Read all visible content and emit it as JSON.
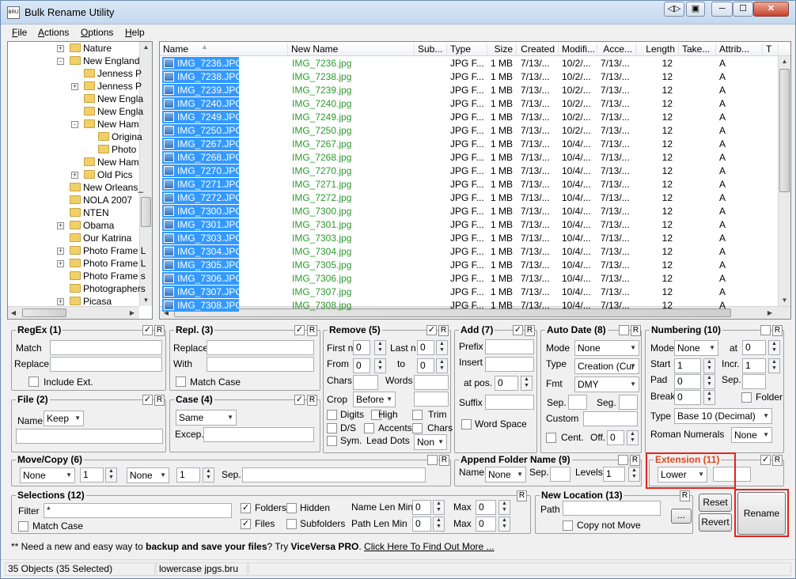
{
  "window": {
    "title": "Bulk Rename Utility",
    "app_icon": "BRU"
  },
  "caption_buttons": {
    "restore_down": "◁▷",
    "icon_box": "▣",
    "minimize": "─",
    "maximize": "☐",
    "close": "✕"
  },
  "menu": [
    {
      "first": "F",
      "rest": "ile"
    },
    {
      "first": "A",
      "rest": "ctions"
    },
    {
      "first": "O",
      "rest": "ptions"
    },
    {
      "first": "H",
      "rest": "elp"
    }
  ],
  "tree": [
    {
      "label": "Nature",
      "level": 1,
      "expander": "+"
    },
    {
      "label": "New England",
      "level": 1,
      "expander": "-"
    },
    {
      "label": "Jenness P",
      "level": 2,
      "expander": ""
    },
    {
      "label": "Jenness P",
      "level": 2,
      "expander": "+"
    },
    {
      "label": "New Engla",
      "level": 2,
      "expander": ""
    },
    {
      "label": "New Engla",
      "level": 2,
      "expander": ""
    },
    {
      "label": "New Ham",
      "level": 2,
      "expander": "-"
    },
    {
      "label": "Origina",
      "level": 3,
      "expander": ""
    },
    {
      "label": "Photo",
      "level": 3,
      "expander": ""
    },
    {
      "label": "New Ham",
      "level": 2,
      "expander": ""
    },
    {
      "label": "Old Pics",
      "level": 2,
      "expander": "+"
    },
    {
      "label": "New Orleans_",
      "level": 1,
      "expander": ""
    },
    {
      "label": "NOLA 2007",
      "level": 1,
      "expander": ""
    },
    {
      "label": "NTEN",
      "level": 1,
      "expander": ""
    },
    {
      "label": "Obama",
      "level": 1,
      "expander": "+"
    },
    {
      "label": "Our Katrina",
      "level": 1,
      "expander": ""
    },
    {
      "label": "Photo Frame L",
      "level": 1,
      "expander": "+"
    },
    {
      "label": "Photo Frame L",
      "level": 1,
      "expander": "+"
    },
    {
      "label": "Photo Frame s",
      "level": 1,
      "expander": ""
    },
    {
      "label": "Photographers",
      "level": 1,
      "expander": ""
    },
    {
      "label": "Picasa",
      "level": 1,
      "expander": "+"
    }
  ],
  "columns": [
    "Name",
    "New Name",
    "Sub...",
    "Type",
    "Size",
    "Created",
    "Modifi...",
    "Acce...",
    "Length",
    "Take...",
    "Attrib...",
    "T"
  ],
  "files": [
    {
      "name": "IMG_7236.JPG",
      "new": "IMG_7236.jpg",
      "type": "JPG F...",
      "size": "1 MB",
      "created": "7/13/...",
      "modified": "10/2/...",
      "accessed": "7/13/...",
      "length": "12",
      "attrib": "A"
    },
    {
      "name": "IMG_7238.JPG",
      "new": "IMG_7238.jpg",
      "type": "JPG F...",
      "size": "1 MB",
      "created": "7/13/...",
      "modified": "10/2/...",
      "accessed": "7/13/...",
      "length": "12",
      "attrib": "A"
    },
    {
      "name": "IMG_7239.JPG",
      "new": "IMG_7239.jpg",
      "type": "JPG F...",
      "size": "1 MB",
      "created": "7/13/...",
      "modified": "10/2/...",
      "accessed": "7/13/...",
      "length": "12",
      "attrib": "A"
    },
    {
      "name": "IMG_7240.JPG",
      "new": "IMG_7240.jpg",
      "type": "JPG F...",
      "size": "1 MB",
      "created": "7/13/...",
      "modified": "10/2/...",
      "accessed": "7/13/...",
      "length": "12",
      "attrib": "A"
    },
    {
      "name": "IMG_7249.JPG",
      "new": "IMG_7249.jpg",
      "type": "JPG F...",
      "size": "1 MB",
      "created": "7/13/...",
      "modified": "10/2/...",
      "accessed": "7/13/...",
      "length": "12",
      "attrib": "A"
    },
    {
      "name": "IMG_7250.JPG",
      "new": "IMG_7250.jpg",
      "type": "JPG F...",
      "size": "1 MB",
      "created": "7/13/...",
      "modified": "10/2/...",
      "accessed": "7/13/...",
      "length": "12",
      "attrib": "A"
    },
    {
      "name": "IMG_7267.JPG",
      "new": "IMG_7267.jpg",
      "type": "JPG F...",
      "size": "1 MB",
      "created": "7/13/...",
      "modified": "10/4/...",
      "accessed": "7/13/...",
      "length": "12",
      "attrib": "A"
    },
    {
      "name": "IMG_7268.JPG",
      "new": "IMG_7268.jpg",
      "type": "JPG F...",
      "size": "1 MB",
      "created": "7/13/...",
      "modified": "10/4/...",
      "accessed": "7/13/...",
      "length": "12",
      "attrib": "A"
    },
    {
      "name": "IMG_7270.JPG",
      "new": "IMG_7270.jpg",
      "type": "JPG F...",
      "size": "1 MB",
      "created": "7/13/...",
      "modified": "10/4/...",
      "accessed": "7/13/...",
      "length": "12",
      "attrib": "A"
    },
    {
      "name": "IMG_7271.JPG",
      "new": "IMG_7271.jpg",
      "type": "JPG F...",
      "size": "1 MB",
      "created": "7/13/...",
      "modified": "10/4/...",
      "accessed": "7/13/...",
      "length": "12",
      "attrib": "A"
    },
    {
      "name": "IMG_7272.JPG",
      "new": "IMG_7272.jpg",
      "type": "JPG F...",
      "size": "1 MB",
      "created": "7/13/...",
      "modified": "10/4/...",
      "accessed": "7/13/...",
      "length": "12",
      "attrib": "A"
    },
    {
      "name": "IMG_7300.JPG",
      "new": "IMG_7300.jpg",
      "type": "JPG F...",
      "size": "1 MB",
      "created": "7/13/...",
      "modified": "10/4/...",
      "accessed": "7/13/...",
      "length": "12",
      "attrib": "A"
    },
    {
      "name": "IMG_7301.JPG",
      "new": "IMG_7301.jpg",
      "type": "JPG F...",
      "size": "1 MB",
      "created": "7/13/...",
      "modified": "10/4/...",
      "accessed": "7/13/...",
      "length": "12",
      "attrib": "A"
    },
    {
      "name": "IMG_7303.JPG",
      "new": "IMG_7303.jpg",
      "type": "JPG F...",
      "size": "1 MB",
      "created": "7/13/...",
      "modified": "10/4/...",
      "accessed": "7/13/...",
      "length": "12",
      "attrib": "A"
    },
    {
      "name": "IMG_7304.JPG",
      "new": "IMG_7304.jpg",
      "type": "JPG F...",
      "size": "1 MB",
      "created": "7/13/...",
      "modified": "10/4/...",
      "accessed": "7/13/...",
      "length": "12",
      "attrib": "A"
    },
    {
      "name": "IMG_7305.JPG",
      "new": "IMG_7305.jpg",
      "type": "JPG F...",
      "size": "1 MB",
      "created": "7/13/...",
      "modified": "10/4/...",
      "accessed": "7/13/...",
      "length": "12",
      "attrib": "A"
    },
    {
      "name": "IMG_7306.JPG",
      "new": "IMG_7306.jpg",
      "type": "JPG F...",
      "size": "1 MB",
      "created": "7/13/...",
      "modified": "10/4/...",
      "accessed": "7/13/...",
      "length": "12",
      "attrib": "A"
    },
    {
      "name": "IMG_7307.JPG",
      "new": "IMG_7307.jpg",
      "type": "JPG F...",
      "size": "1 MB",
      "created": "7/13/...",
      "modified": "10/4/...",
      "accessed": "7/13/...",
      "length": "12",
      "attrib": "A"
    },
    {
      "name": "IMG_7308.JPG",
      "new": "IMG_7308.jpg",
      "type": "JPG F...",
      "size": "1 MB",
      "created": "7/13/...",
      "modified": "10/4/...",
      "accessed": "7/13/...",
      "length": "12",
      "attrib": "A"
    }
  ],
  "panels": {
    "regex": {
      "title": "RegEx (1)",
      "match": "Match",
      "replace": "Replace",
      "include_ext": "Include Ext."
    },
    "repl": {
      "title": "Repl. (3)",
      "replace": "Replace",
      "with": "With",
      "match_case": "Match Case"
    },
    "remove": {
      "title": "Remove (5)",
      "first_n": "First n",
      "first_n_val": "0",
      "last_n": "Last n",
      "last_n_val": "0",
      "from": "From",
      "from_val": "0",
      "to": "to",
      "to_val": "0",
      "chars": "Chars",
      "words": "Words",
      "crop": "Crop",
      "crop_val": "Before",
      "digits": "Digits",
      "high": "High",
      "trim": "Trim",
      "ds": "D/S",
      "accents": "Accents",
      "chars2": "Chars",
      "sym": "Sym.",
      "lead_dots": "Lead Dots",
      "lead_dots_val": "Non"
    },
    "add": {
      "title": "Add (7)",
      "prefix": "Prefix",
      "insert": "Insert",
      "at_pos": "at pos.",
      "at_pos_val": "0",
      "suffix": "Suffix",
      "word_space": "Word Space"
    },
    "autodate": {
      "title": "Auto Date (8)",
      "mode": "Mode",
      "mode_val": "None",
      "type": "Type",
      "type_val": "Creation (Cur",
      "fmt": "Fmt",
      "fmt_val": "DMY",
      "sep": "Sep.",
      "seg": "Seg.",
      "custom": "Custom",
      "cent": "Cent.",
      "off": "Off.",
      "off_val": "0"
    },
    "numbering": {
      "title": "Numbering (10)",
      "mode": "Mode",
      "mode_val": "None",
      "at": "at",
      "at_val": "0",
      "start": "Start",
      "start_val": "1",
      "incr": "Incr.",
      "incr_val": "1",
      "pad": "Pad",
      "pad_val": "0",
      "sep": "Sep.",
      "break": "Break",
      "break_val": "0",
      "folder": "Folder",
      "type": "Type",
      "type_val": "Base 10 (Decimal)",
      "roman": "Roman Numerals",
      "roman_val": "None"
    },
    "file": {
      "title": "File (2)",
      "name": "Name",
      "name_val": "Keep"
    },
    "case": {
      "title": "Case (4)",
      "case_val": "Same",
      "excep": "Excep."
    },
    "movecopy": {
      "title": "Move/Copy (6)",
      "sel1": "None",
      "num1": "1",
      "sel2": "None",
      "num2": "1",
      "sep": "Sep."
    },
    "append": {
      "title": "Append Folder Name (9)",
      "name": "Name",
      "name_val": "None",
      "sep": "Sep.",
      "levels": "Levels",
      "levels_val": "1"
    },
    "extension": {
      "title": "Extension (11)",
      "val": "Lower"
    },
    "selections": {
      "title": "Selections (12)",
      "filter": "Filter",
      "filter_val": "*",
      "match_case": "Match Case",
      "folders": "Folders",
      "hidden": "Hidden",
      "files": "Files",
      "subfolders": "Subfolders",
      "name_len_min": "Name Len Min",
      "name_len_min_val": "0",
      "max": "Max",
      "name_max_val": "0",
      "path_len_min": "Path Len Min",
      "path_len_min_val": "0",
      "path_max_val": "0"
    },
    "newloc": {
      "title": "New Location (13)",
      "path": "Path",
      "copy_not_move": "Copy not Move",
      "browse": "..."
    }
  },
  "r_label": "R",
  "check_mark": "✓",
  "buttons": {
    "reset": "Reset",
    "revert": "Revert",
    "rename": "Rename"
  },
  "promo": {
    "prefix": "** Need a new and easy way to ",
    "bold": "backup and save your files",
    "mid": "? Try ",
    "brand": "ViceVersa PRO",
    "dot": ". ",
    "link": "Click Here To Find Out More ..."
  },
  "status": {
    "objects": "35 Objects (35 Selected)",
    "file": "lowercase jpgs.bru",
    "empty": ""
  }
}
